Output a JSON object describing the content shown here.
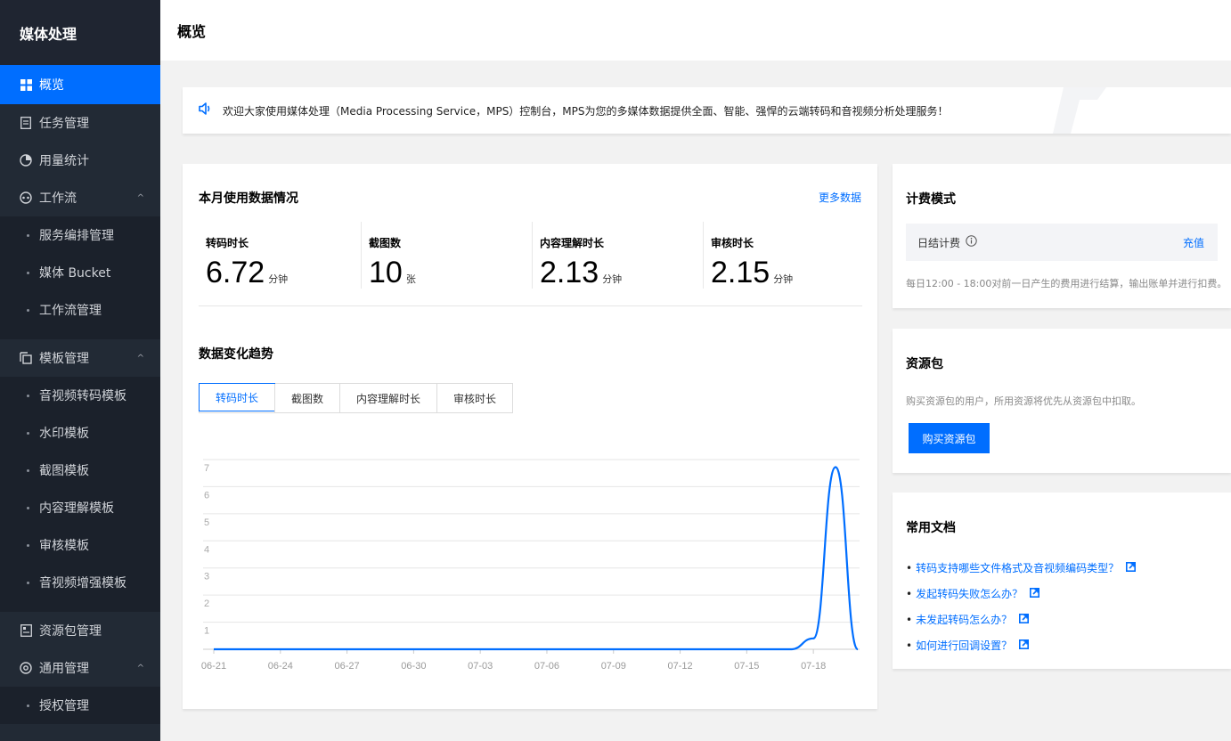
{
  "sidebar": {
    "title": "媒体处理",
    "items": {
      "overview": "概览",
      "tasks": "任务管理",
      "usage": "用量统计",
      "workflow": "工作流",
      "service_orchestration": "服务编排管理",
      "media_bucket": "媒体 Bucket",
      "workflow_mgmt": "工作流管理",
      "templates": "模板管理",
      "transcode_tpl": "音视频转码模板",
      "watermark_tpl": "水印模板",
      "snapshot_tpl": "截图模板",
      "content_tpl": "内容理解模板",
      "review_tpl": "审核模板",
      "enhance_tpl": "音视频增强模板",
      "packages": "资源包管理",
      "general": "通用管理",
      "auth": "授权管理"
    }
  },
  "header": {
    "title": "概览"
  },
  "notice": {
    "text": "欢迎大家使用媒体处理（Media Processing Service，MPS）控制台，MPS为您的多媒体数据提供全面、智能、强悍的云端转码和音视频分析处理服务！"
  },
  "usage": {
    "title": "本月使用数据情况",
    "more": "更多数据",
    "stats": [
      {
        "label": "转码时长",
        "value": "6.72",
        "unit": "分钟"
      },
      {
        "label": "截图数",
        "value": "10",
        "unit": "张"
      },
      {
        "label": "内容理解时长",
        "value": "2.13",
        "unit": "分钟"
      },
      {
        "label": "审核时长",
        "value": "2.15",
        "unit": "分钟"
      }
    ],
    "trend_title": "数据变化趋势",
    "tabs": [
      "转码时长",
      "截图数",
      "内容理解时长",
      "审核时长"
    ],
    "active_tab": 0
  },
  "chart_data": {
    "type": "line",
    "title": "",
    "xlabel": "",
    "ylabel": "",
    "ylim": [
      0,
      7
    ],
    "yticks": [
      1,
      2,
      3,
      4,
      5,
      6,
      7
    ],
    "xticks": [
      "06-21",
      "06-24",
      "06-27",
      "06-30",
      "07-03",
      "07-06",
      "07-09",
      "07-12",
      "07-15",
      "07-18"
    ],
    "x": [
      "06-21",
      "06-22",
      "06-23",
      "06-24",
      "06-25",
      "06-26",
      "06-27",
      "06-28",
      "06-29",
      "06-30",
      "07-01",
      "07-02",
      "07-03",
      "07-04",
      "07-05",
      "07-06",
      "07-07",
      "07-08",
      "07-09",
      "07-10",
      "07-11",
      "07-12",
      "07-13",
      "07-14",
      "07-15",
      "07-16",
      "07-17",
      "07-18",
      "07-19",
      "07-20"
    ],
    "series": [
      {
        "values": [
          0,
          0,
          0,
          0,
          0,
          0,
          0,
          0,
          0,
          0,
          0,
          0,
          0,
          0,
          0,
          0,
          0,
          0,
          0,
          0,
          0,
          0,
          0,
          0,
          0,
          0,
          0,
          0.4,
          6.72,
          0
        ]
      }
    ],
    "grid": true,
    "color": "#006eff"
  },
  "billing": {
    "title": "计费模式",
    "mode": "日结计费",
    "recharge": "充值",
    "desc": "每日12:00 - 18:00对前一日产生的费用进行结算，输出账单并进行扣费。"
  },
  "package": {
    "title": "资源包",
    "desc": "购买资源包的用户，所用资源将优先从资源包中扣取。",
    "button": "购买资源包"
  },
  "docs": {
    "title": "常用文档",
    "items": [
      "转码支持哪些文件格式及音视频编码类型？",
      "发起转码失败怎么办？",
      "未发起转码怎么办？",
      "如何进行回调设置？"
    ]
  },
  "colors": {
    "accent": "#006eff",
    "sidebar": "#222a35"
  }
}
